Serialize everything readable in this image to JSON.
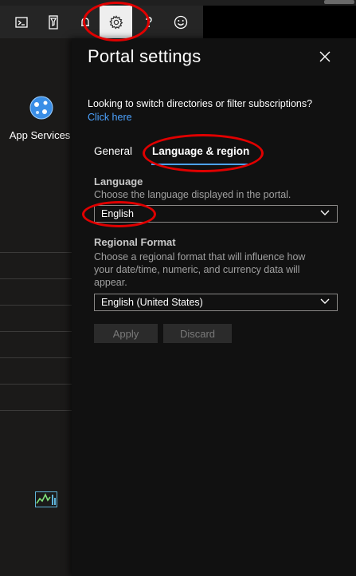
{
  "toolbar": {
    "items": [
      {
        "icon": "cloud-shell-icon"
      },
      {
        "icon": "directory-filter-icon"
      },
      {
        "icon": "notifications-icon"
      },
      {
        "icon": "settings-icon",
        "active": true
      },
      {
        "icon": "help-icon"
      },
      {
        "icon": "feedback-smiley-icon"
      }
    ]
  },
  "sidebar": {
    "app_services_label": "App Services"
  },
  "panel": {
    "title": "Portal settings",
    "info_text": "Looking to switch directories or filter subscriptions?",
    "info_link": "Click here",
    "tabs": [
      {
        "label": "General",
        "active": false
      },
      {
        "label": "Language & region",
        "active": true
      }
    ],
    "language": {
      "title": "Language",
      "description": "Choose the language displayed in the portal.",
      "value": "English"
    },
    "regional": {
      "title": "Regional Format",
      "description": "Choose a regional format that will influence how your date/time, numeric, and currency data will appear.",
      "value": "English (United States)"
    },
    "buttons": {
      "apply": "Apply",
      "discard": "Discard"
    }
  },
  "colors": {
    "annotation": "#e00000",
    "link": "#4da3ff",
    "tab_underline": "#4da3ff",
    "panel_bg": "#111111"
  }
}
